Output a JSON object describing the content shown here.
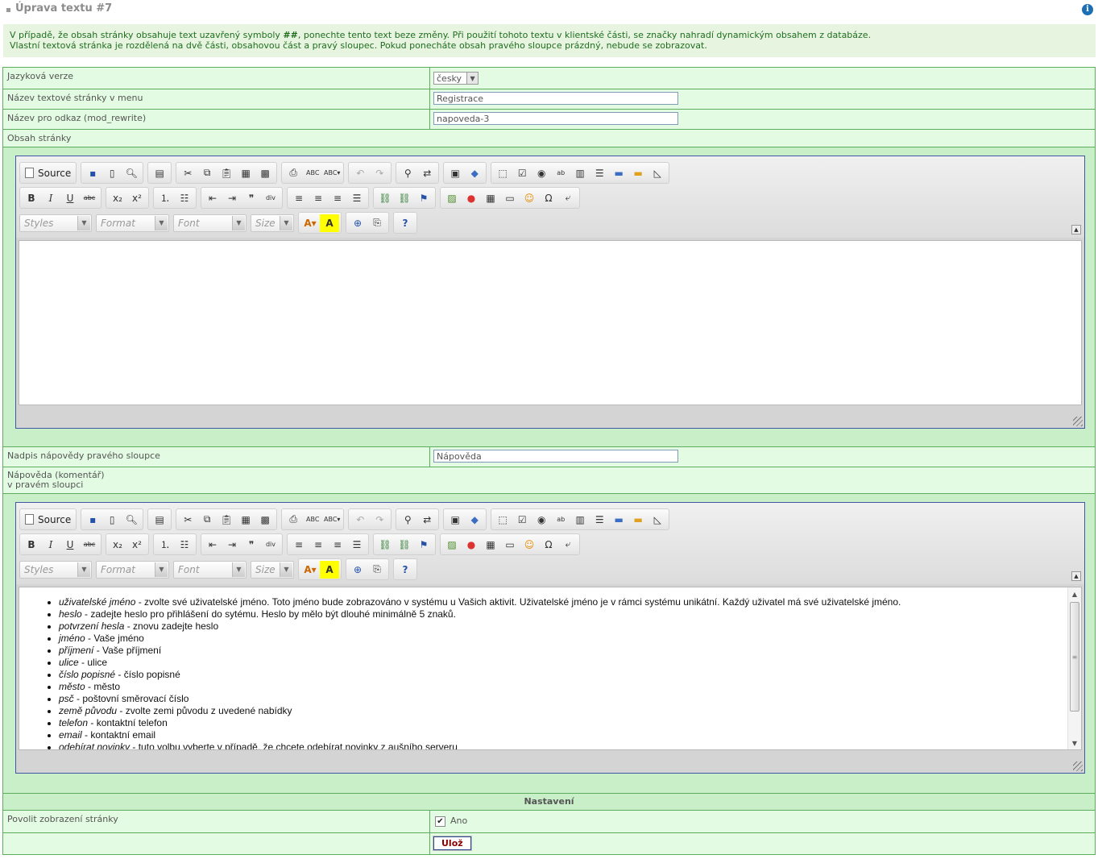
{
  "page": {
    "title": "Úprava textu #7",
    "info_icon": "info-icon"
  },
  "notice": {
    "line1_before": "V případě, že obsah stránky obsahuje text uzavřený symboly ",
    "line1_symbol": "##",
    "line1_after": ", ponechte tento text beze změny. Při použití tohoto textu v klientské části, se značky nahradí dynamickým obsahem z databáze.",
    "line2": "Vlastní textová stránka je rozdělená na dvě části, obsahovou část a pravý sloupec. Pokud ponecháte obsah pravého sloupce prázdný, nebude se zobrazovat."
  },
  "form": {
    "language": {
      "label": "Jazyková verze",
      "value": "česky"
    },
    "menu_name": {
      "label": "Název textové stránky v menu",
      "value": "Registrace"
    },
    "link_name": {
      "label": "Název pro odkaz (mod_rewrite)",
      "value": "napoveda-3"
    },
    "content": {
      "label": "Obsah stránky"
    },
    "help_title": {
      "label": "Nadpis nápovědy pravého sloupce",
      "value": "Nápověda"
    },
    "help_comment": {
      "label_line1": "Nápověda (komentář)",
      "label_line2": "v pravém sloupci"
    },
    "settings_header": "Nastavení",
    "allow_display": {
      "label": "Povolit zobrazení stránky",
      "checkbox_label": "Ano",
      "checked": true
    },
    "save_label": "Ulož"
  },
  "editor_toolbar": {
    "source_label": "Source",
    "combos": {
      "styles": "Styles",
      "format": "Format",
      "font": "Font",
      "size": "Size"
    }
  },
  "help_items": [
    {
      "term": "uživatelské jméno",
      "desc": " - zvolte své uživatelské jméno. Toto jméno bude zobrazováno v systému u Vašich aktivit. Uživatelské jméno je v rámci systému unikátní. Každý uživatel má své uživatelské jméno."
    },
    {
      "term": "heslo",
      "desc": " - zadejte heslo pro přihlášení do sytému. Heslo by mělo být dlouhé minimálně 5 znaků."
    },
    {
      "term": "potvrzení hesla",
      "desc": " - znovu zadejte heslo"
    },
    {
      "term": "jméno",
      "desc": " - Vaše jméno"
    },
    {
      "term": "příjmení",
      "desc": " - Vaše příjmení"
    },
    {
      "term": "ulice",
      "desc": " - ulice"
    },
    {
      "term": "číslo popisné",
      "desc": " - číslo popisné"
    },
    {
      "term": "město",
      "desc": " - město"
    },
    {
      "term": "psč",
      "desc": " - poštovní směrovací číslo"
    },
    {
      "term": "země původu",
      "desc": " - zvolte zemi původu z uvedené nabídky"
    },
    {
      "term": "telefon",
      "desc": " - kontaktní telefon"
    },
    {
      "term": "email",
      "desc": " - kontaktní email"
    },
    {
      "term": "odebírat novinky",
      "desc": " - tuto volbu vyberte v případě, že chcete odebírat novinky z aušního serveru"
    }
  ]
}
